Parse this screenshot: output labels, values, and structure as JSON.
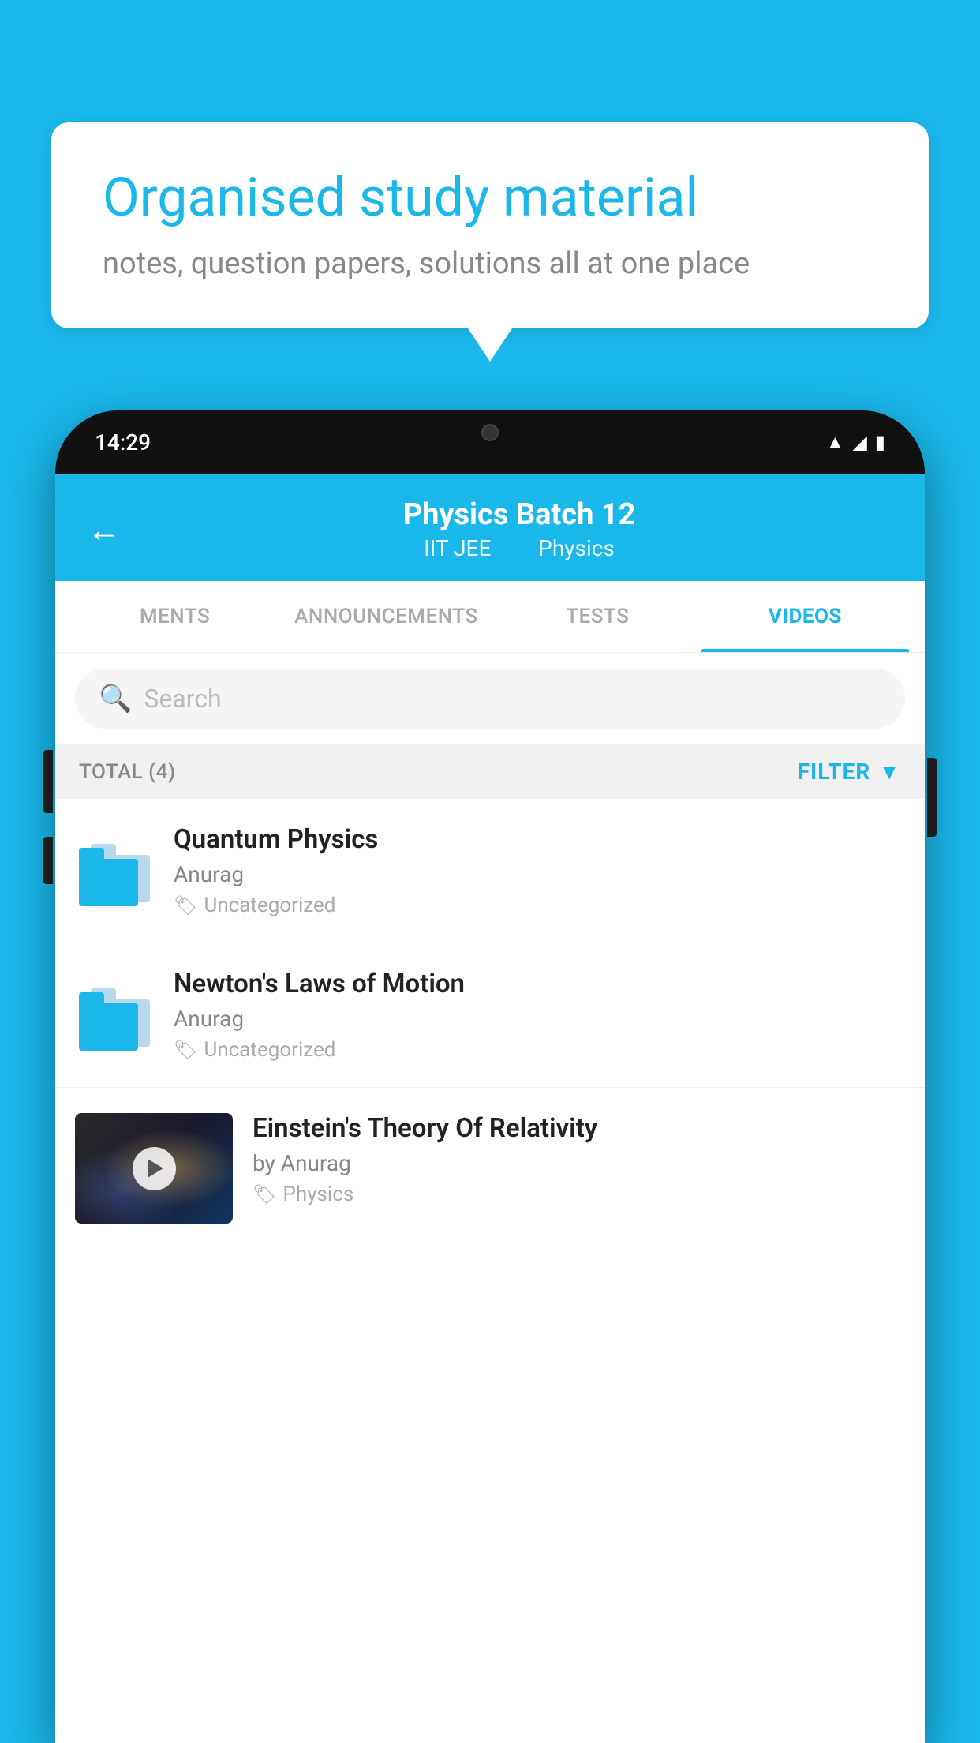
{
  "background_color": "#1ab7ea",
  "speech_bubble": {
    "heading": "Organised study material",
    "subtext": "notes, question papers, solutions all at one place"
  },
  "phone": {
    "status_bar": {
      "time": "14:29",
      "icons": [
        "wifi",
        "signal",
        "battery"
      ]
    },
    "app_header": {
      "back_label": "←",
      "title": "Physics Batch 12",
      "subtitle_parts": [
        "IIT JEE",
        "Physics"
      ]
    },
    "tabs": [
      {
        "label": "MENTS",
        "active": false
      },
      {
        "label": "ANNOUNCEMENTS",
        "active": false
      },
      {
        "label": "TESTS",
        "active": false
      },
      {
        "label": "VIDEOS",
        "active": true
      }
    ],
    "search": {
      "placeholder": "Search"
    },
    "filter_bar": {
      "total_label": "TOTAL (4)",
      "filter_label": "FILTER"
    },
    "video_items": [
      {
        "id": 1,
        "title": "Quantum Physics",
        "author": "Anurag",
        "tag": "Uncategorized",
        "type": "folder"
      },
      {
        "id": 2,
        "title": "Newton's Laws of Motion",
        "author": "Anurag",
        "tag": "Uncategorized",
        "type": "folder"
      },
      {
        "id": 3,
        "title": "Einstein's Theory Of Relativity",
        "author": "by Anurag",
        "tag": "Physics",
        "type": "video"
      }
    ]
  }
}
